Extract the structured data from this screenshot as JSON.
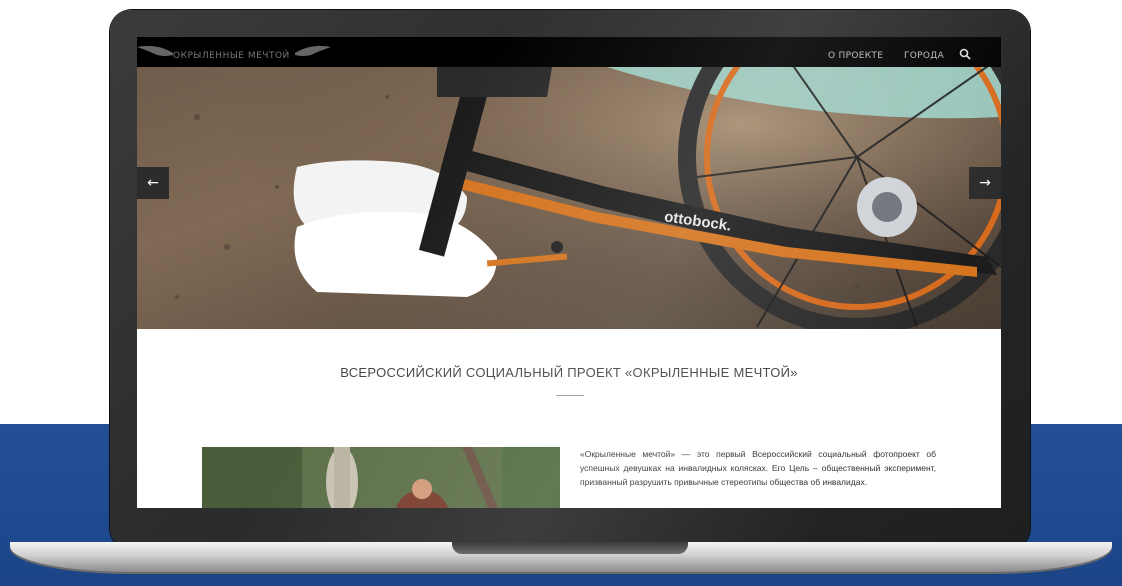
{
  "site": {
    "logo_text": "ОКРЫЛЕННЫЕ МЕЧТОЙ",
    "nav_items": [
      "О ПРОЕКТЕ",
      "ГОРОДА"
    ],
    "prev_arrow": "←",
    "next_arrow": "→",
    "hero_brand": "ottobock.",
    "section_title": "ВСЕРОССИЙСКИЙ СОЦИАЛЬНЫЙ ПРОЕКТ «ОКРЫЛЕННЫЕ МЕЧТОЙ»",
    "description": "«Окрыленные мечтой» — это первый Всероссийский социальный фотопроект об успешных девушках на инвалидных колясках. Его Цель – общественный эксперимент, призванный разрушить привычные стереотипы общества об инвалидах."
  },
  "colors": {
    "background_band": "#234f97",
    "laptop_bezel": "#2b2c2e",
    "nav_bar": "#000000",
    "accent_orange": "#e07a2a"
  }
}
